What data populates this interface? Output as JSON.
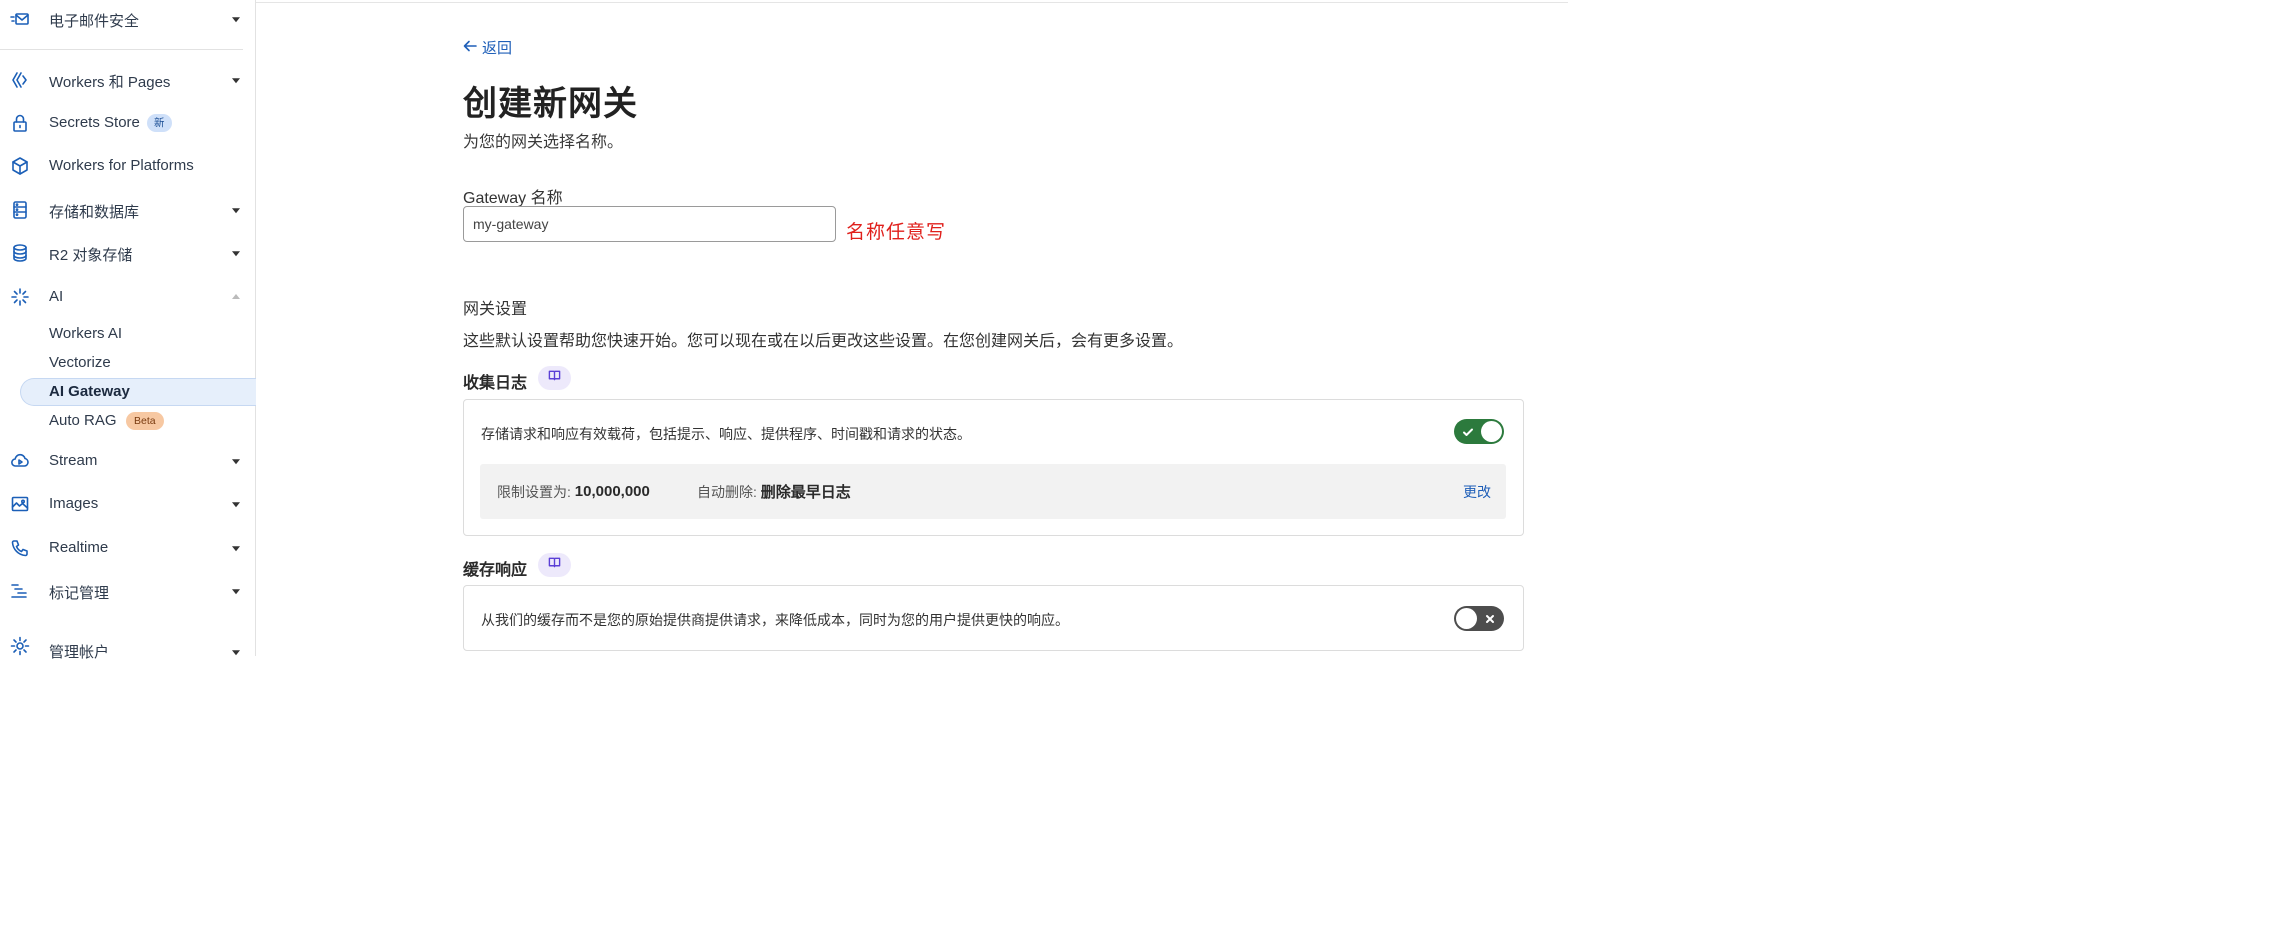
{
  "sidebar": {
    "email_security": "电子邮件安全",
    "workers_pages": "Workers 和 Pages",
    "secrets_store": "Secrets Store",
    "secrets_badge": "新",
    "workers_platforms": "Workers for Platforms",
    "storage_db": "存储和数据库",
    "r2": "R2 对象存储",
    "ai": "AI",
    "ai_sub": {
      "workers_ai": "Workers AI",
      "vectorize": "Vectorize",
      "ai_gateway": "AI Gateway",
      "auto_rag": "Auto RAG",
      "auto_rag_badge": "Beta"
    },
    "stream": "Stream",
    "images": "Images",
    "realtime": "Realtime",
    "tag_mgmt": "标记管理",
    "manage_account": "管理帐户"
  },
  "main": {
    "back": "返回",
    "title": "创建新网关",
    "subtitle": "为您的网关选择名称。",
    "name_label": "Gateway 名称",
    "name_value": "my-gateway",
    "annotation": "名称任意写",
    "settings_title": "网关设置",
    "settings_desc": "这些默认设置帮助您快速开始。您可以现在或在以后更改这些设置。在您创建网关后，会有更多设置。",
    "logs": {
      "title": "收集日志",
      "desc": "存储请求和响应有效载荷，包括提示、响应、提供程序、时间戳和请求的状态。",
      "enabled": true,
      "limit_label": "限制设置为:",
      "limit_value": "10,000,000",
      "auto_delete_label": "自动删除:",
      "auto_delete_value": "删除最早日志",
      "change": "更改"
    },
    "cache": {
      "title": "缓存响应",
      "desc": "从我们的缓存而不是您的原始提供商提供请求，来降低成本，同时为您的用户提供更快的响应。",
      "enabled": false
    }
  },
  "colors": {
    "accent": "#1f5fb8",
    "toggle_on": "#2c7a3d",
    "toggle_off": "#4d4d4d",
    "annotation": "#e0201c"
  }
}
